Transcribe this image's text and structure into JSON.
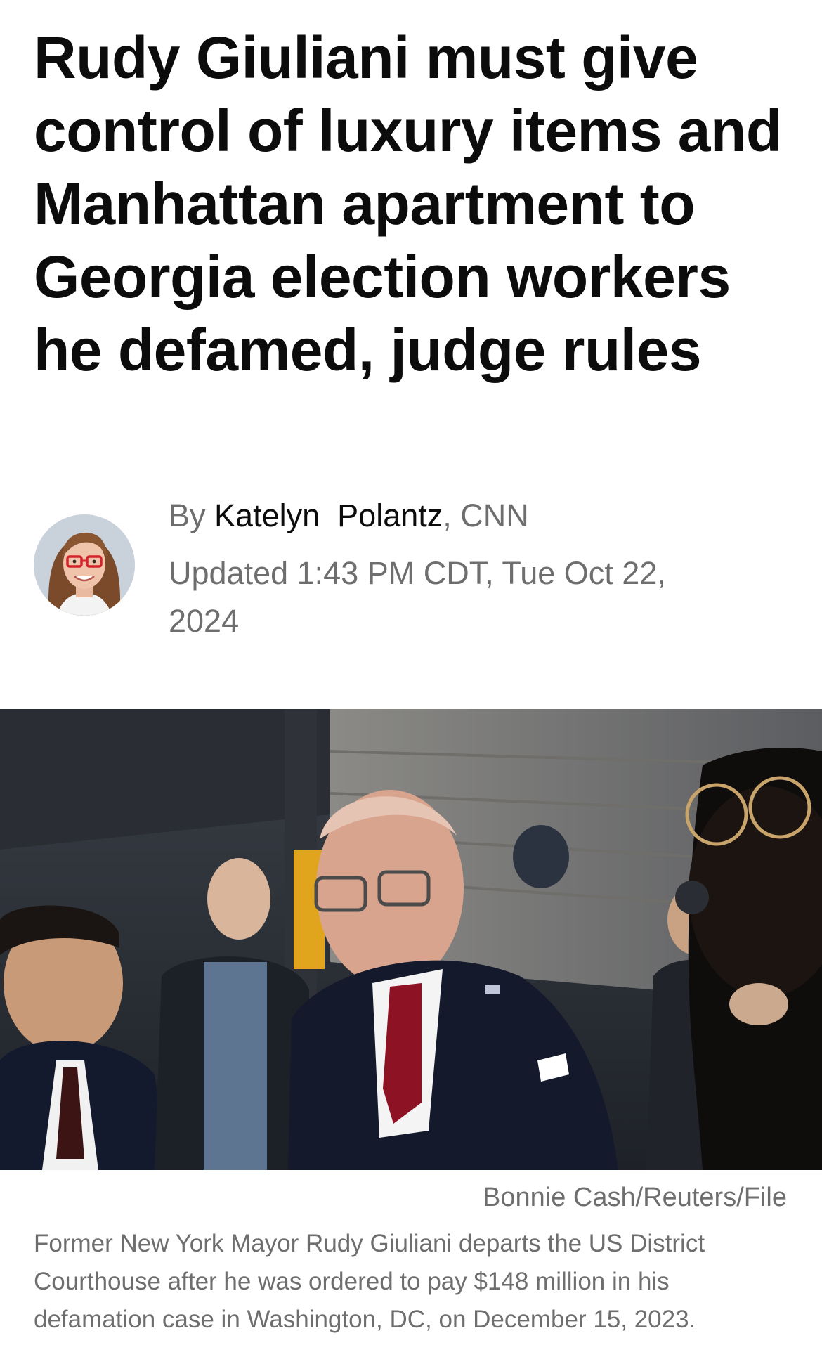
{
  "article": {
    "headline": "Rudy Giuliani must give control of luxury items and Manhattan apartment to Georgia election workers he defamed, judge rules",
    "byline": {
      "prefix": "By ",
      "author_first": "Katelyn",
      "author_last": "Polantz",
      "source": ", CNN",
      "updated": "Updated 1:43 PM CDT, Tue Oct 22, 2024"
    },
    "photo": {
      "credit": "Bonnie Cash/Reuters/File",
      "caption": "Former New York Mayor Rudy Giuliani departs the US District Courthouse after he was ordered to pay $148 million in his defamation case in Washington, DC, on December 15, 2023."
    }
  },
  "colors": {
    "text": "#0c0c0c",
    "muted": "#6e6e6e",
    "background": "#ffffff"
  }
}
